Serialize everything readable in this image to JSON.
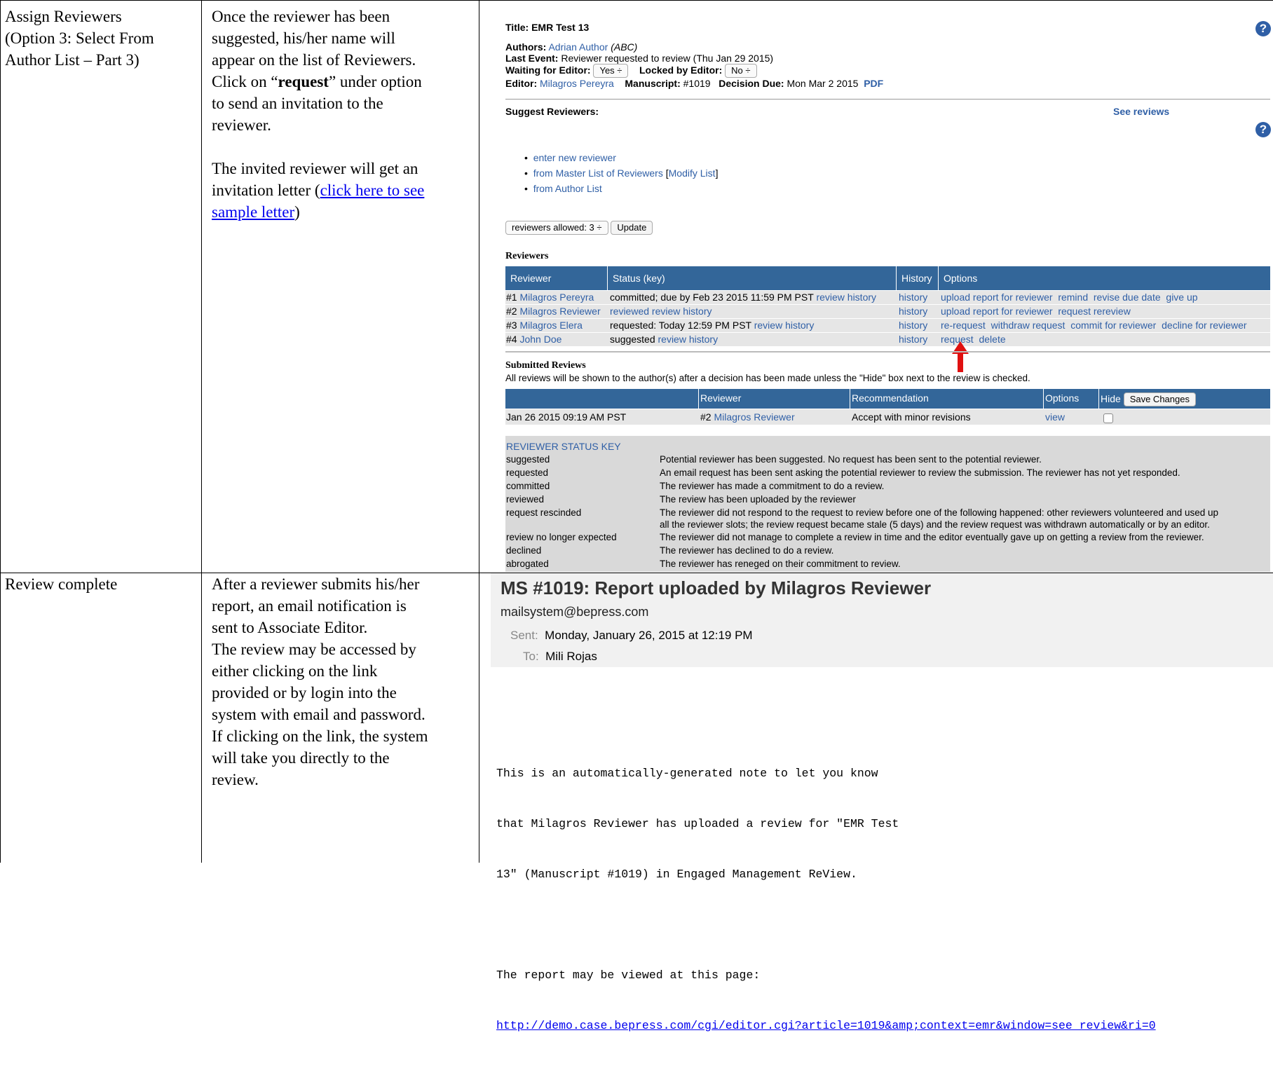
{
  "doc_table": {
    "row1": {
      "title_lines": [
        "Assign Reviewers",
        "(Option 3: Select From",
        "Author List – Part 3)"
      ],
      "desc_lines_pre": [
        "Once the reviewer has been",
        "suggested, his/her name will",
        "appear on the list of Reviewers."
      ],
      "desc_click_pre": "Click on “",
      "desc_click_bold": "request",
      "desc_click_post": "” under option",
      "desc_lines_post": [
        "to send an invitation to the",
        "reviewer."
      ],
      "desc2_lines": [
        "The invited reviewer will get an"
      ],
      "desc2_pre": "invitation letter (",
      "desc2_link1": "click here to see",
      "desc2_link2": "sample letter",
      "desc2_post": ")"
    },
    "row2": {
      "title": "Review complete",
      "desc_lines": [
        "After a reviewer submits his/her",
        "report, an email notification is",
        "sent to Associate Editor.",
        "The review may be accessed by",
        "either clicking on the link",
        "provided or by login into the",
        "system with email and password.",
        "If clicking on the link, the system",
        "will take you directly to the",
        "review."
      ]
    }
  },
  "editor_panel": {
    "title_label": "Title:",
    "title_value": "EMR Test 13",
    "authors_label": "Authors:",
    "authors_value": "Adrian Author",
    "authors_affil": "(ABC)",
    "last_event_label": "Last Event:",
    "last_event_value": "Reviewer requested to review (Thu Jan 29 2015)",
    "waiting_label": "Waiting for Editor:",
    "waiting_value": "Yes ÷",
    "locked_label": "Locked by Editor:",
    "locked_value": "No ÷",
    "editor_label": "Editor:",
    "editor_value": "Milagros Pereyra",
    "manuscript_label": "Manuscript:",
    "manuscript_value": "#1019",
    "decision_label": "Decision Due:",
    "decision_value": "Mon Mar 2 2015",
    "pdf_link": "PDF",
    "suggest_heading": "Suggest Reviewers:",
    "see_reviews": "See reviews",
    "suggest_items": [
      "enter new reviewer",
      "from Master List of Reviewers",
      "from Author List"
    ],
    "modify_list_pre": "[",
    "modify_list": "Modify List",
    "modify_list_post": "]",
    "reviewers_allowed": "reviewers allowed: 3 ÷",
    "update_button": "Update",
    "reviewers_heading": "Reviewers",
    "reviewers_table": {
      "headers": [
        "Reviewer",
        "Status (key)",
        "History",
        "Options"
      ],
      "rows": [
        {
          "num": "#1",
          "name": "Milagros Pereyra",
          "status": "committed; due by Feb 23 2015 11:59 PM PST",
          "status_link": "review history",
          "history": "history",
          "options": [
            "upload report for reviewer",
            "remind",
            "revise due date",
            "give up"
          ]
        },
        {
          "num": "#2",
          "name": "Milagros Reviewer",
          "status": "",
          "status_link": "reviewed review history",
          "history": "history",
          "options": [
            "upload report for reviewer",
            "request rereview"
          ]
        },
        {
          "num": "#3",
          "name": "Milagros Elera",
          "status": "requested: Today 12:59 PM PST",
          "status_link": "review history",
          "history": "history",
          "options": [
            "re-request",
            "withdraw request",
            "commit for reviewer",
            "decline for reviewer"
          ]
        },
        {
          "num": "#4",
          "name": "John Doe",
          "status": "suggested",
          "status_link": "review history",
          "history": "history",
          "options": [
            "request",
            "delete"
          ]
        }
      ]
    },
    "submitted_heading": "Submitted Reviews",
    "submitted_note": "All reviews will be shown to the author(s) after a decision has been made unless the \"Hide\" box next to the review is checked.",
    "submitted_table": {
      "headers": [
        "",
        "Reviewer",
        "Recommendation",
        "Options",
        "Hide"
      ],
      "save_button": "Save Changes",
      "row": {
        "date": "Jan 26 2015 09:19 AM PST",
        "reviewer_num": "#2",
        "reviewer_name": "Milagros Reviewer",
        "recommendation": "Accept with minor revisions",
        "option": "view"
      }
    },
    "status_key": {
      "heading": "REVIEWER STATUS KEY",
      "rows": [
        {
          "term": "suggested",
          "desc": [
            "Potential reviewer has been suggested. No request has been sent to the potential reviewer."
          ]
        },
        {
          "term": "requested",
          "desc": [
            "An email request has been sent asking the potential reviewer to review the submission. The reviewer has not yet responded."
          ]
        },
        {
          "term": "committed",
          "desc": [
            "The reviewer has made a commitment to do a review."
          ]
        },
        {
          "term": "reviewed",
          "desc": [
            "The review has been uploaded by the reviewer"
          ]
        },
        {
          "term": "request rescinded",
          "desc": [
            "The reviewer did not respond to the request to review before one of the following happened: other reviewers volunteered and used up",
            "all the reviewer slots; the review request became stale (5 days) and the review request was withdrawn automatically or by an editor."
          ]
        },
        {
          "term": "review no longer expected",
          "desc": [
            "The reviewer did not manage to complete a review in time and the editor eventually gave up on getting a review from the reviewer."
          ]
        },
        {
          "term": "declined",
          "desc": [
            "The reviewer has declined to do a review."
          ]
        },
        {
          "term": "abrogated",
          "desc": [
            "The reviewer has reneged on their commitment to review."
          ]
        }
      ]
    }
  },
  "email": {
    "subject": "MS #1019: Report uploaded by Milagros Reviewer",
    "from": "mailsystem@bepress.com",
    "sent_label": "Sent:",
    "sent_value": "Monday, January 26, 2015 at 12:19 PM",
    "to_label": "To:",
    "to_value": "Mili Rojas",
    "body_lines": [
      "This is an automatically-generated note to let you know",
      "that Milagros Reviewer has uploaded a review for \"EMR Test",
      "13\" (Manuscript #1019) in Engaged Management ReView."
    ],
    "report_line": "The report may be viewed at this page:",
    "report_url": "http://demo.case.bepress.com/cgi/editor.cgi?article=1019&amp;context=emr&window=see_review&ri=0"
  },
  "colors": {
    "link": "#2f5fa6",
    "header_bar": "#336699",
    "arrow": "#e01010",
    "row_bg": "#e6e6e6",
    "key_bg": "#d9d9d9"
  }
}
